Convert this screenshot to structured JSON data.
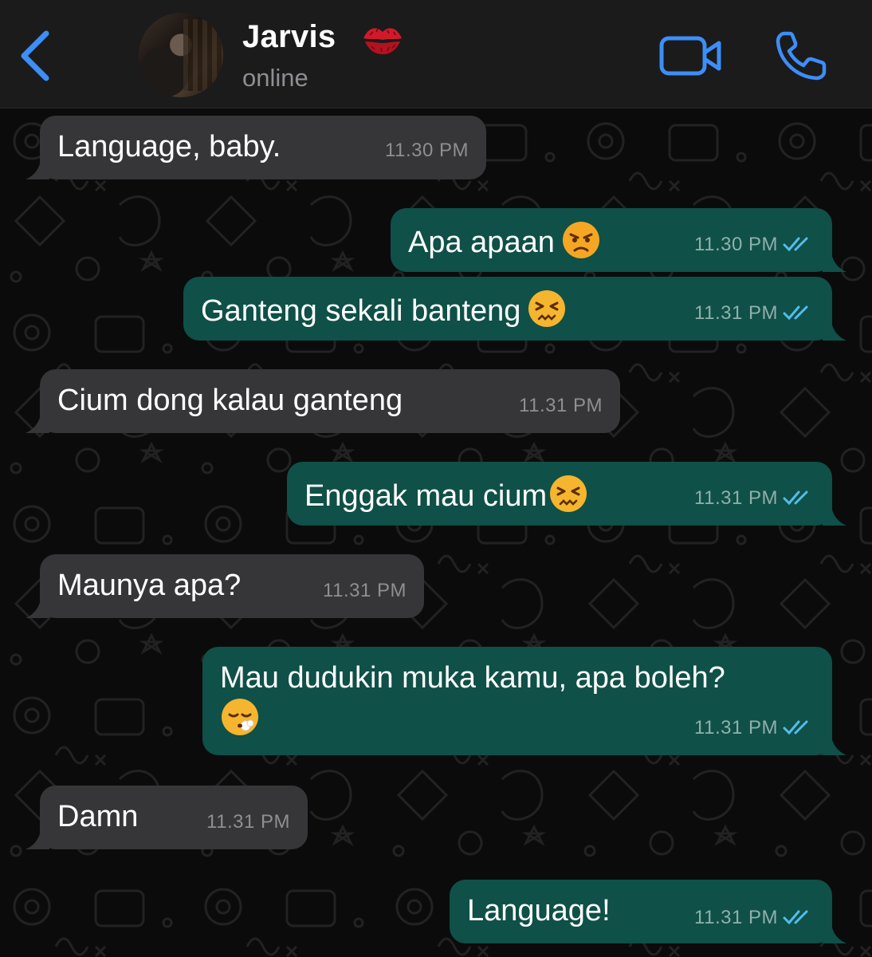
{
  "header": {
    "contact_name": "Jarvis",
    "status": "online",
    "icons": {
      "back": "chevron-left-icon",
      "video": "video-camera-icon",
      "call": "phone-icon",
      "kiss": "kiss-mark-icon"
    },
    "accent_color": "#3d8ef7"
  },
  "colors": {
    "incoming_bubble": "#363638",
    "outgoing_bubble": "#0f5048",
    "read_ticks": "#53bdeb"
  },
  "messages": [
    {
      "direction": "incoming",
      "text": "Language, baby.",
      "time": "11.30 PM"
    },
    {
      "direction": "outgoing",
      "text": "Apa apaan",
      "emoji": "pouting-face",
      "time": "11.30 PM",
      "read": true
    },
    {
      "direction": "outgoing",
      "text": "Ganteng sekali banteng",
      "emoji": "confounded-face",
      "time": "11.31 PM",
      "read": true
    },
    {
      "direction": "incoming",
      "text": "Cium dong kalau ganteng",
      "time": "11.31 PM"
    },
    {
      "direction": "outgoing",
      "text": "Enggak mau cium",
      "emoji": "confounded-face",
      "time": "11.31 PM",
      "read": true
    },
    {
      "direction": "incoming",
      "text": "Maunya apa?",
      "time": "11.31 PM"
    },
    {
      "direction": "outgoing",
      "text": "Mau dudukin muka kamu, apa boleh?",
      "emoji": "face-exhaling",
      "time": "11.31 PM",
      "read": true
    },
    {
      "direction": "incoming",
      "text": "Damn",
      "time": "11.31 PM"
    },
    {
      "direction": "outgoing",
      "text": "Language!",
      "time": "11.31 PM",
      "read": true
    }
  ]
}
